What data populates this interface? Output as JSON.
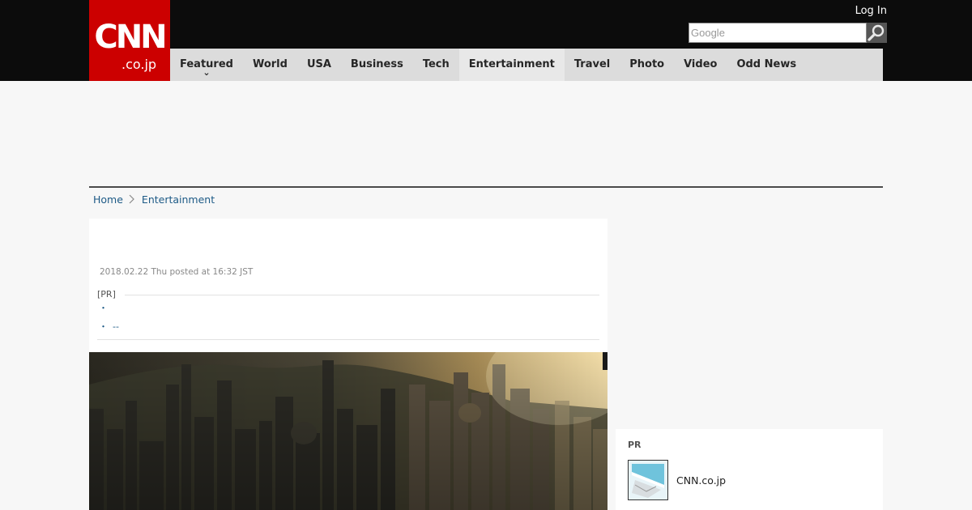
{
  "header": {
    "logo_main": "CNN",
    "logo_sub": ".co.jp",
    "login": "Log In",
    "search_placeholder": "Google"
  },
  "nav": {
    "items": [
      {
        "label": "Featured",
        "has_dropdown": true
      },
      {
        "label": "World"
      },
      {
        "label": "USA"
      },
      {
        "label": "Business"
      },
      {
        "label": "Tech"
      },
      {
        "label": "Entertainment",
        "active": true
      },
      {
        "label": "Travel"
      },
      {
        "label": "Photo"
      },
      {
        "label": "Video"
      },
      {
        "label": "Odd News"
      }
    ]
  },
  "breadcrumb": {
    "home": "Home",
    "current": "Entertainment"
  },
  "article": {
    "meta": "2018.02.22 Thu posted at 16:32 JST",
    "pr_label": "[PR]",
    "bullet_1": "・",
    "bullet_2": "・",
    "bullet_2_link": "--"
  },
  "sidebar": {
    "pr_title": "PR",
    "pr_item_name": "CNN.co.jp"
  },
  "colors": {
    "brand_red": "#cc0000",
    "header_bg": "#0c0c0c",
    "nav_bg": "#dcdcdc",
    "link": "#1d5a86"
  }
}
